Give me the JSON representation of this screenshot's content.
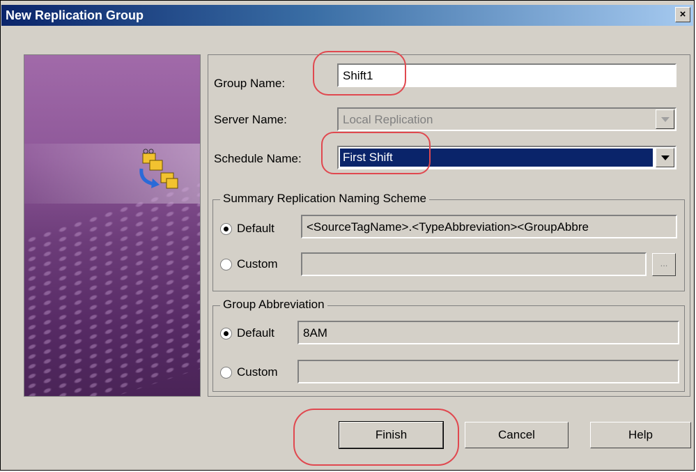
{
  "window": {
    "title": "New Replication Group",
    "close_label": "×"
  },
  "fields": {
    "group_name_label": "Group Name:",
    "group_name_value": "Shift1",
    "server_name_label": "Server Name:",
    "server_name_value": "Local Replication",
    "schedule_name_label": "Schedule Name:",
    "schedule_name_value": "First Shift"
  },
  "summary_scheme": {
    "legend": "Summary Replication Naming Scheme",
    "default_label": "Default",
    "default_value": "<SourceTagName>.<TypeAbbreviation><GroupAbbre",
    "custom_label": "Custom",
    "custom_value": "",
    "browse_label": "..."
  },
  "group_abbreviation": {
    "legend": "Group Abbreviation",
    "default_label": "Default",
    "default_value": "8AM",
    "custom_label": "Custom",
    "custom_value": ""
  },
  "buttons": {
    "finish": "Finish",
    "cancel": "Cancel",
    "help": "Help"
  },
  "colors": {
    "highlight": "#e0484f",
    "title_start": "#0a246a",
    "selection": "#0a246a"
  }
}
